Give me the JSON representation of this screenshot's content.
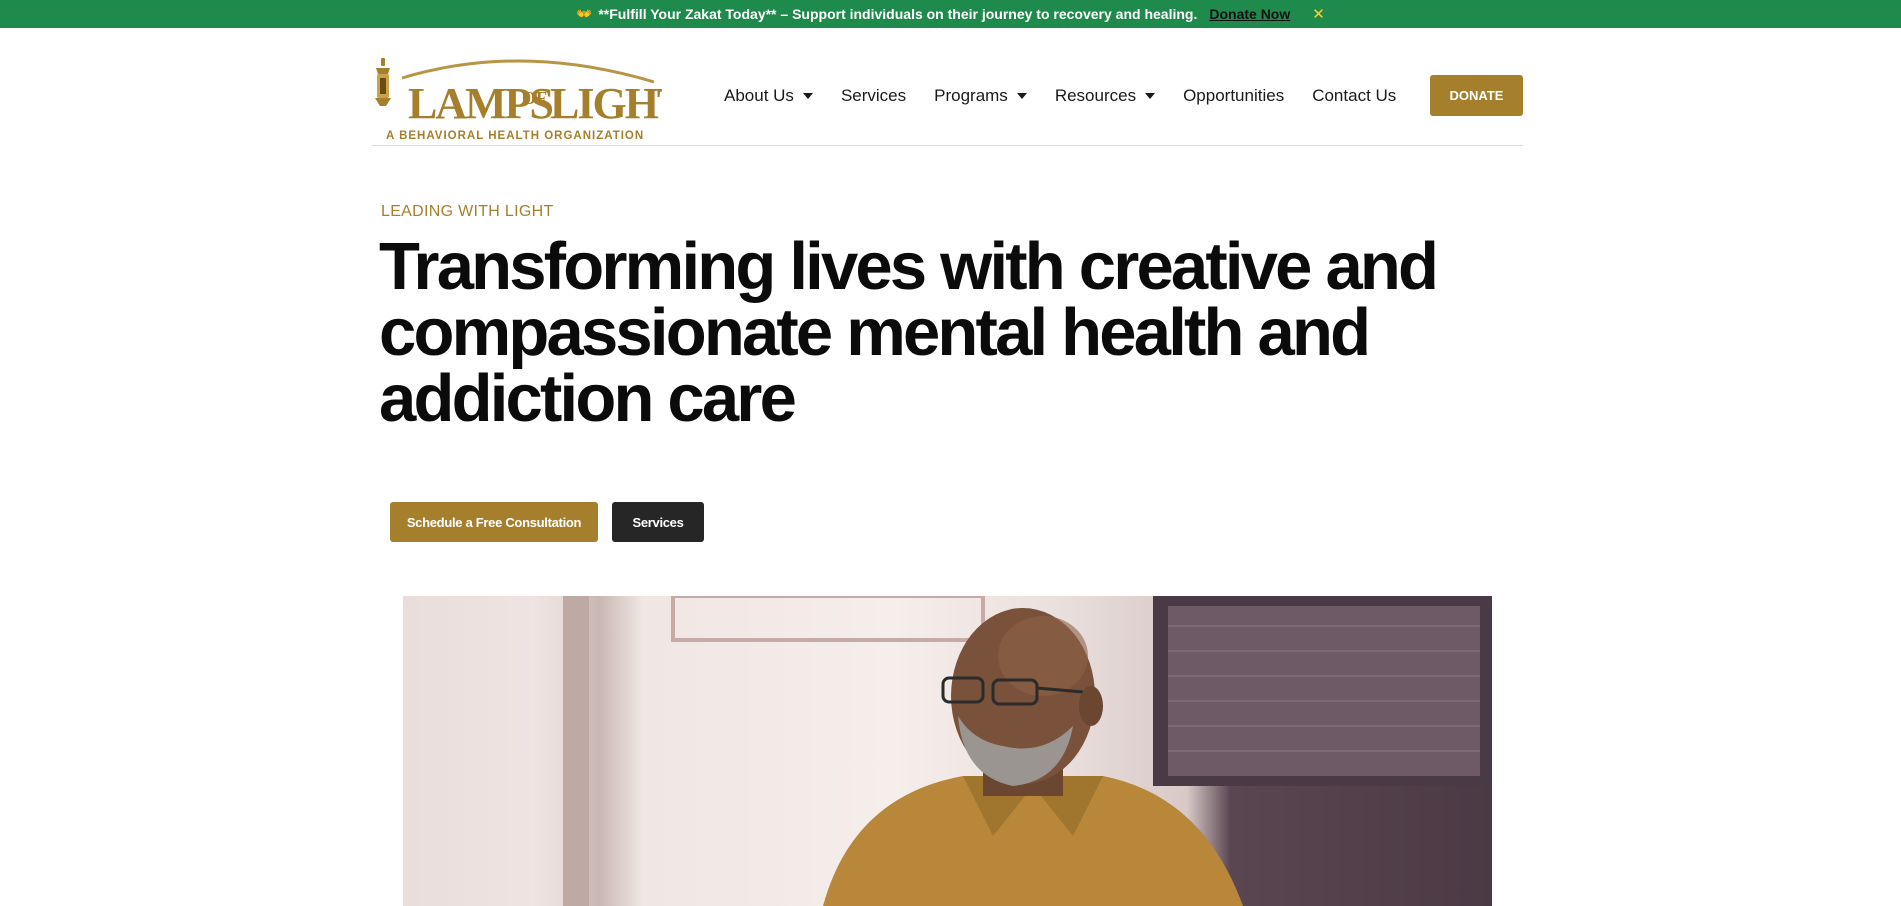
{
  "announcement": {
    "icon": "praying-hands-icon",
    "text": "**Fulfill Your Zakat Today** – Support individuals on their journey to recovery and healing.",
    "link_label": "Donate Now",
    "close_label": "✕"
  },
  "logo": {
    "brand": "LAMPS OF LIGHT",
    "tagline": "A BEHAVIORAL HEALTH ORGANIZATION"
  },
  "nav": {
    "items": [
      {
        "label": "About Us",
        "has_dropdown": true
      },
      {
        "label": "Services",
        "has_dropdown": false
      },
      {
        "label": "Programs",
        "has_dropdown": true
      },
      {
        "label": "Resources",
        "has_dropdown": true
      },
      {
        "label": "Opportunities",
        "has_dropdown": false
      },
      {
        "label": "Contact Us",
        "has_dropdown": false
      }
    ],
    "donate_label": "DONATE"
  },
  "hero": {
    "eyebrow": "LEADING WITH LIGHT",
    "headline": "Transforming lives with creative and compassionate mental health and addiction care",
    "primary_cta": "Schedule a Free Consultation",
    "secondary_cta": "Services"
  },
  "colors": {
    "announcement_bg": "#1e8a4c",
    "brand_gold": "#a67f2c",
    "dark_button": "#262626"
  }
}
